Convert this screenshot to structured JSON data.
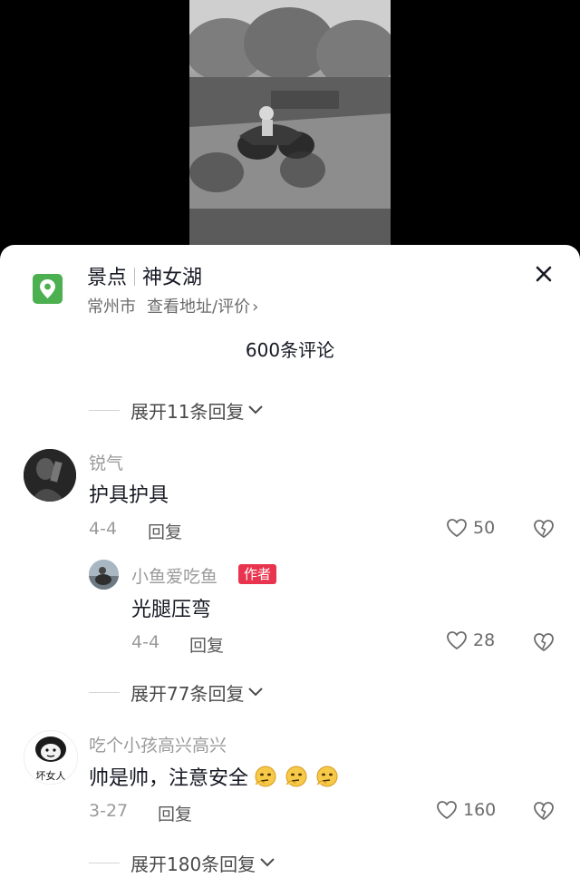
{
  "location": {
    "category": "景点",
    "name": "神女湖",
    "city": "常州市",
    "link_label": "查看地址/评价",
    "link_arrow": "›"
  },
  "comments_header": {
    "count_label": "600条评论"
  },
  "threads": [
    {
      "expand_label": "展开11条回复"
    },
    {
      "username": "锐气",
      "text": "护具护具",
      "date": "4-4",
      "reply_label": "回复",
      "likes": "50",
      "reply": {
        "username": "小鱼爱吃鱼",
        "badge": "作者",
        "text": "光腿压弯",
        "date": "4-4",
        "reply_label": "回复",
        "likes": "28"
      },
      "expand_label": "展开77条回复"
    },
    {
      "username": "吃个小孩高兴高兴",
      "text": "帅是帅，注意安全",
      "date": "3-27",
      "reply_label": "回复",
      "likes": "160",
      "avatar_text": "坏女人",
      "expand_label": "展开180条回复"
    }
  ],
  "icons": {
    "location": "map-pin-icon",
    "close": "close-icon",
    "like": "heart-outline-icon",
    "dislike": "broken-heart-icon",
    "expand": "chevron-down-icon",
    "emoji": "thinking-face-emoji"
  },
  "colors": {
    "location_icon_bg": "#4caf50",
    "author_badge": "#e8344e",
    "sheet_bg": "#ffffff"
  }
}
